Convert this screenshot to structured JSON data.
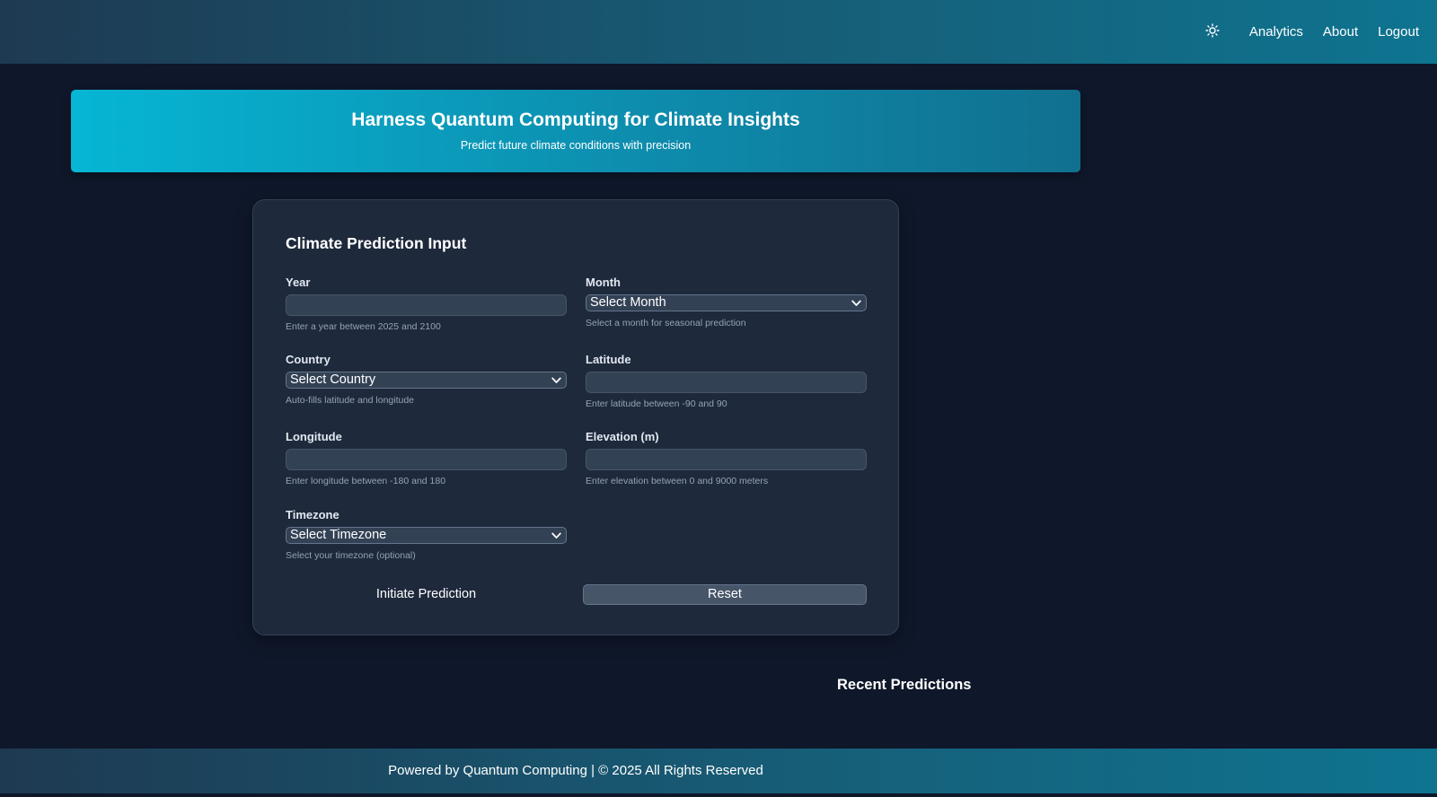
{
  "nav": {
    "theme_icon": "sun-icon",
    "items": [
      {
        "label": "Analytics"
      },
      {
        "label": "About"
      },
      {
        "label": "Logout"
      }
    ]
  },
  "hero": {
    "title": "Harness Quantum Computing for Climate Insights",
    "subtitle": "Predict future climate conditions with precision"
  },
  "form": {
    "title": "Climate Prediction Input",
    "year": {
      "label": "Year",
      "value": "",
      "hint": "Enter a year between 2025 and 2100"
    },
    "month": {
      "label": "Month",
      "selected": "Select Month",
      "hint": "Select a month for seasonal prediction"
    },
    "country": {
      "label": "Country",
      "selected": "Select Country",
      "hint": "Auto-fills latitude and longitude"
    },
    "latitude": {
      "label": "Latitude",
      "value": "",
      "hint": "Enter latitude between -90 and 90"
    },
    "longitude": {
      "label": "Longitude",
      "value": "",
      "hint": "Enter longitude between -180 and 180"
    },
    "elevation": {
      "label": "Elevation (m)",
      "value": "",
      "hint": "Enter elevation between 0 and 9000 meters"
    },
    "timezone": {
      "label": "Timezone",
      "selected": "Select Timezone",
      "hint": "Select your timezone (optional)"
    },
    "submit_label": "Initiate Prediction",
    "reset_label": "Reset"
  },
  "recent": {
    "title": "Recent Predictions"
  },
  "footer": {
    "text": "Powered by Quantum Computing | © 2025 All Rights Reserved"
  },
  "colors": {
    "background": "#0f172a",
    "card": "#1e293b",
    "accent": "#06b6d4",
    "input": "#334155"
  }
}
